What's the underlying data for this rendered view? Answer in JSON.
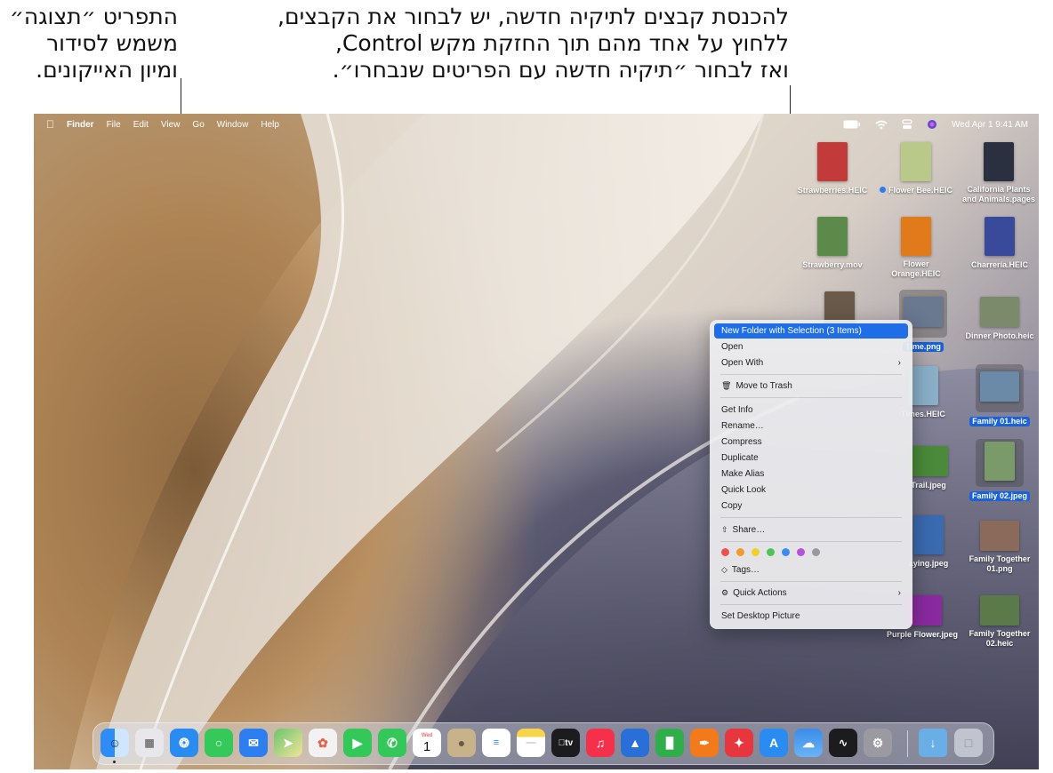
{
  "callouts": {
    "view_menu": [
      "התפריט ״תצוגה״",
      "משמש לסידור",
      "ומיון האייקונים."
    ],
    "new_folder": [
      "להכנסת קבצים לתיקיה חדשה, יש לבחור את הקבצים,",
      "ללחוץ על אחד מהם תוך החזקת מקש Control,",
      "ואז לבחור ״תיקיה חדשה עם הפריטים שנבחרו״."
    ]
  },
  "menubar": {
    "app": "Finder",
    "items": [
      "File",
      "Edit",
      "View",
      "Go",
      "Window",
      "Help"
    ],
    "datetime": "Wed Apr 1  9:41 AM",
    "icons": [
      "apple-icon",
      "battery-icon",
      "wifi-icon",
      "control-center-icon",
      "siri-icon"
    ]
  },
  "desktop_icons": [
    {
      "name": "Strawberries.HEIC",
      "color": "#c23a3a",
      "selected": false
    },
    {
      "name": "Flower Bee.HEIC",
      "color": "#b9c98a",
      "selected": false,
      "tag": "#2e7bf5"
    },
    {
      "name": "California Plants and Animals.pages",
      "color": "#2b3040",
      "selected": false
    },
    {
      "name": "Strawberry.mov",
      "color": "#5c8a4a",
      "selected": false
    },
    {
      "name": "Flower Orange.HEIC",
      "color": "#e07a1a",
      "selected": false
    },
    {
      "name": "Charrería.HEIC",
      "color": "#3a4a9a",
      "selected": false
    },
    {
      "name": "Time.png",
      "color": "#6a7890",
      "selected": true
    },
    {
      "name": "Dinner Photo.heic",
      "color": "#7a8a6a",
      "selected": false
    },
    {
      "name": "Times.HEIC",
      "color": "#8ab0c8",
      "selected": false
    },
    {
      "name": "Family 01.heic",
      "color": "#6a8aa8",
      "selected": true
    },
    {
      "name": "Trail.jpeg",
      "color": "#4a8a3a",
      "selected": false
    },
    {
      "name": "Family 02.jpeg",
      "color": "#7a9a6a",
      "selected": true
    },
    {
      "name": "aying.jpeg",
      "color": "#3a6ab0",
      "selected": false
    },
    {
      "name": "Family Together 01.png",
      "color": "#8a6a5a",
      "selected": false
    },
    {
      "name": "Purple Flower.jpeg",
      "color": "#8a2aa0",
      "selected": false
    },
    {
      "name": "Family Together 02.heic",
      "color": "#5a7a4a",
      "selected": false
    }
  ],
  "context_menu": {
    "new_folder": "New Folder with Selection (3 Items)",
    "open": "Open",
    "open_with": "Open With",
    "move_to_trash": "Move to Trash",
    "get_info": "Get Info",
    "rename": "Rename…",
    "compress": "Compress",
    "duplicate": "Duplicate",
    "make_alias": "Make Alias",
    "quick_look": "Quick Look",
    "copy": "Copy",
    "share": "Share…",
    "tags": "Tags…",
    "quick_actions": "Quick Actions",
    "set_desktop_picture": "Set Desktop Picture",
    "tag_colors": [
      "#f04f4f",
      "#f39a2e",
      "#f4cf2c",
      "#4fc35a",
      "#3b8cf0",
      "#b552d8",
      "#9a9a9e"
    ],
    "chevron": "›"
  },
  "dock": {
    "calendar_day": "Wed",
    "calendar_date": "1",
    "tv_label": "tv",
    "apps": [
      {
        "name": "finder",
        "color": "#2f8cf5"
      },
      {
        "name": "launchpad",
        "color": "#e8e8ec"
      },
      {
        "name": "safari",
        "color": "#2a8cf0"
      },
      {
        "name": "messages",
        "color": "#35c95a"
      },
      {
        "name": "mail",
        "color": "#2d7ff0"
      },
      {
        "name": "maps",
        "color": "#5bb860"
      },
      {
        "name": "photos",
        "color": "#f2f2f2"
      },
      {
        "name": "facetime",
        "color": "#34c759"
      },
      {
        "name": "phone",
        "color": "#34c759"
      },
      {
        "name": "calendar",
        "color": "#ffffff"
      },
      {
        "name": "contacts",
        "color": "#c8b28a"
      },
      {
        "name": "reminders",
        "color": "#ffffff"
      },
      {
        "name": "notes",
        "color": "#f7d44a"
      },
      {
        "name": "tv",
        "color": "#1c1c1e"
      },
      {
        "name": "music",
        "color": "#f5304a"
      },
      {
        "name": "keynote",
        "color": "#2a6fd8"
      },
      {
        "name": "numbers",
        "color": "#2fae4a"
      },
      {
        "name": "pages",
        "color": "#f27a1a"
      },
      {
        "name": "games",
        "color": "#e8363e"
      },
      {
        "name": "app-store",
        "color": "#2a8cf0"
      },
      {
        "name": "weather",
        "color": "#3a8ce8"
      },
      {
        "name": "stocks",
        "color": "#1c1c1e"
      },
      {
        "name": "system-settings",
        "color": "#9a9aa0"
      },
      {
        "name": "downloads",
        "color": "#6aaee8"
      },
      {
        "name": "trash",
        "color": "#d8dde5"
      }
    ]
  }
}
